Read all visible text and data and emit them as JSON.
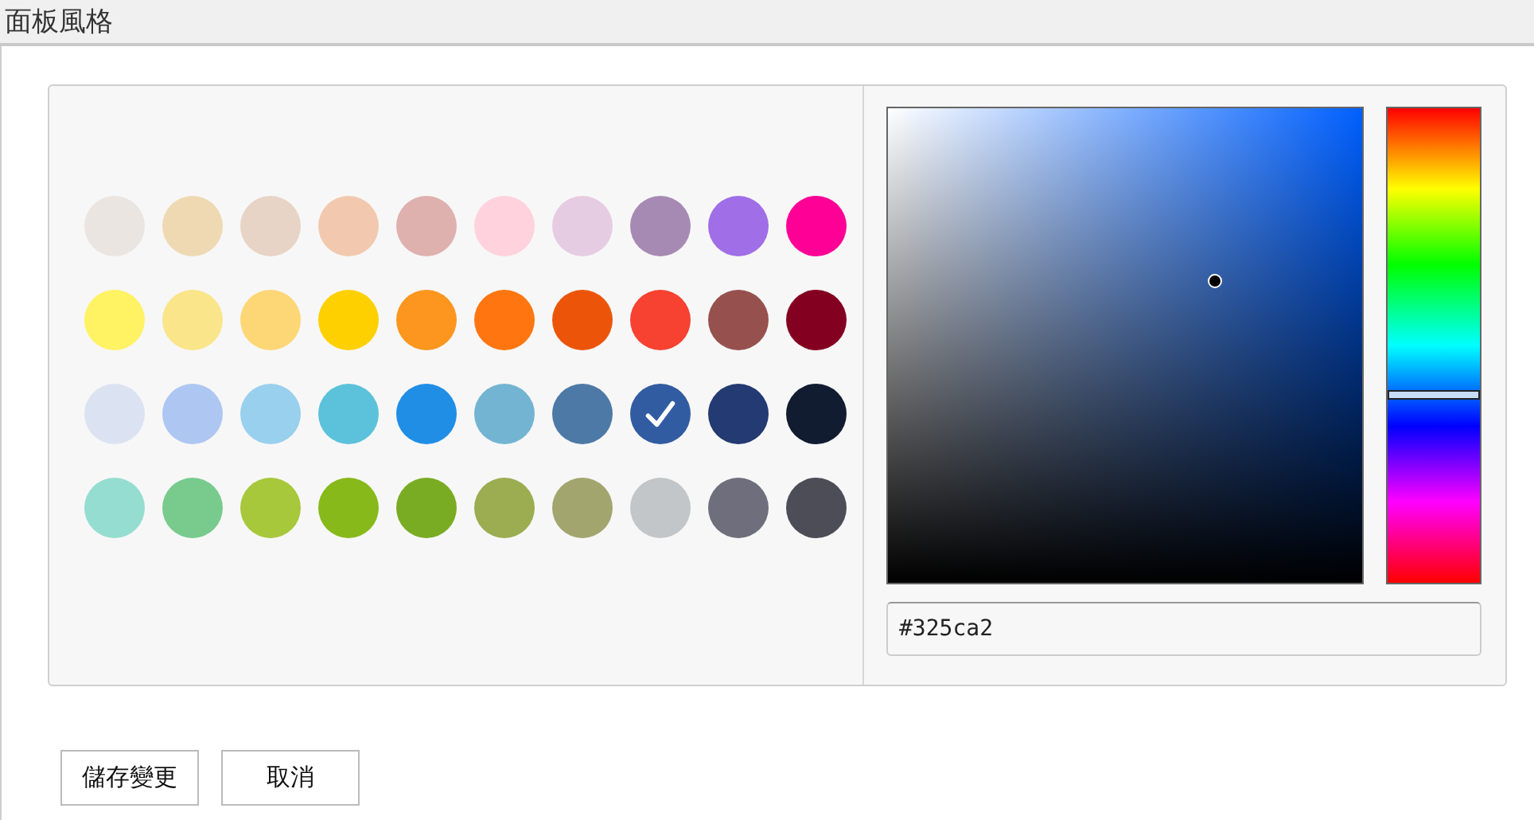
{
  "header": {
    "title": "面板風格"
  },
  "swatches": [
    {
      "color": "#ebe5e2",
      "selected": false
    },
    {
      "color": "#eed9b2",
      "selected": false
    },
    {
      "color": "#e8d4c6",
      "selected": false
    },
    {
      "color": "#f2c9ae",
      "selected": false
    },
    {
      "color": "#dfb1ae",
      "selected": false
    },
    {
      "color": "#ffd2dd",
      "selected": false
    },
    {
      "color": "#e6cce2",
      "selected": false
    },
    {
      "color": "#a68ab4",
      "selected": false
    },
    {
      "color": "#a06ee6",
      "selected": false
    },
    {
      "color": "#ff0096",
      "selected": false
    },
    {
      "color": "#fff263",
      "selected": false
    },
    {
      "color": "#fae58a",
      "selected": false
    },
    {
      "color": "#fdd675",
      "selected": false
    },
    {
      "color": "#ffd000",
      "selected": false
    },
    {
      "color": "#fc961f",
      "selected": false
    },
    {
      "color": "#ff7611",
      "selected": false
    },
    {
      "color": "#ec5509",
      "selected": false
    },
    {
      "color": "#f74131",
      "selected": false
    },
    {
      "color": "#96514e",
      "selected": false
    },
    {
      "color": "#840021",
      "selected": false
    },
    {
      "color": "#dbe3f3",
      "selected": false
    },
    {
      "color": "#aec6f2",
      "selected": false
    },
    {
      "color": "#99d0ee",
      "selected": false
    },
    {
      "color": "#5cc2db",
      "selected": false
    },
    {
      "color": "#218ee6",
      "selected": false
    },
    {
      "color": "#73b4d2",
      "selected": false
    },
    {
      "color": "#4d79a6",
      "selected": false
    },
    {
      "color": "#325ca2",
      "selected": true
    },
    {
      "color": "#233a72",
      "selected": false
    },
    {
      "color": "#111c31",
      "selected": false
    },
    {
      "color": "#95ddd1",
      "selected": false
    },
    {
      "color": "#78cb8d",
      "selected": false
    },
    {
      "color": "#a6c83a",
      "selected": false
    },
    {
      "color": "#87b91b",
      "selected": false
    },
    {
      "color": "#7aac23",
      "selected": false
    },
    {
      "color": "#9cac51",
      "selected": false
    },
    {
      "color": "#a2a66e",
      "selected": false
    },
    {
      "color": "#c2c6c9",
      "selected": false
    },
    {
      "color": "#6e6e7d",
      "selected": false
    },
    {
      "color": "#4d4d58",
      "selected": false
    }
  ],
  "picker": {
    "hex_field": {
      "value": "#325ca2"
    }
  },
  "buttons": [
    {
      "label": "儲存變更"
    },
    {
      "label": "取消"
    }
  ]
}
